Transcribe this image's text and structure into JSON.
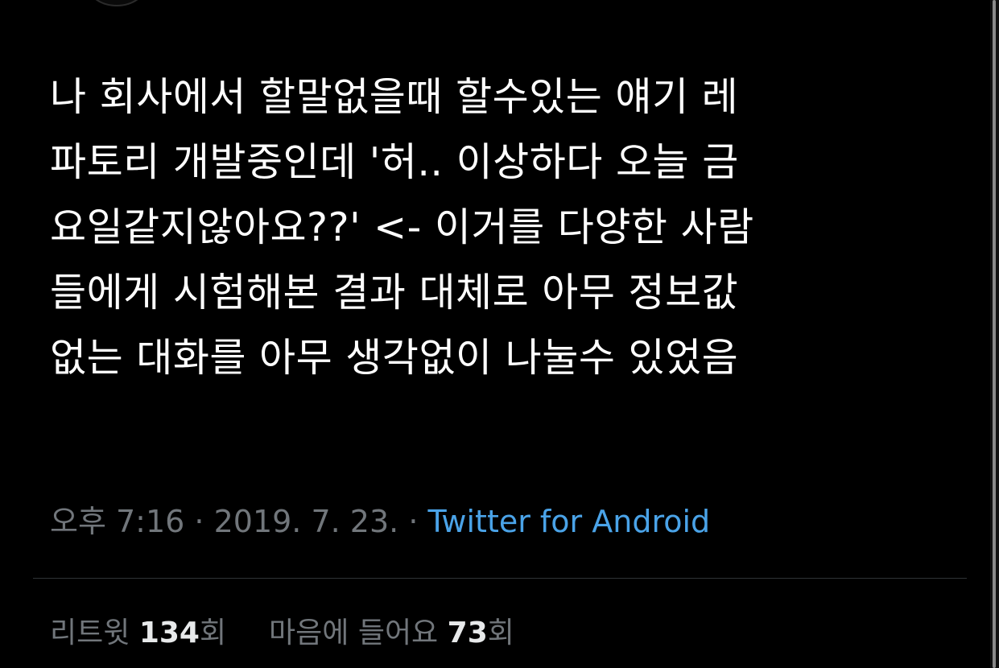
{
  "tweet": {
    "lines": [
      "나 회사에서 할말없을때 할수있는 얘기 레",
      "파토리 개발중인데 '허.. 이상하다 오늘 금",
      "요일같지않아요??' <- 이거를 다양한 사람",
      "들에게 시험해본 결과 대체로 아무 정보값",
      "없는 대화를 아무 생각없이 나눌수 있었음"
    ]
  },
  "meta": {
    "time": "오후 7:16",
    "separator1": " · ",
    "date": "2019. 7. 23.",
    "separator2": " · ",
    "source": "Twitter for Android"
  },
  "stats": {
    "retweets_label": "리트윗",
    "retweets_count": "134",
    "retweets_unit": "회",
    "likes_label": "마음에 들어요",
    "likes_count": "73",
    "likes_unit": "회"
  },
  "colors": {
    "background": "#000000",
    "text": "#ffffff",
    "secondary_text": "#71767b",
    "link": "#4aa3e8",
    "divider": "#2f3336"
  }
}
